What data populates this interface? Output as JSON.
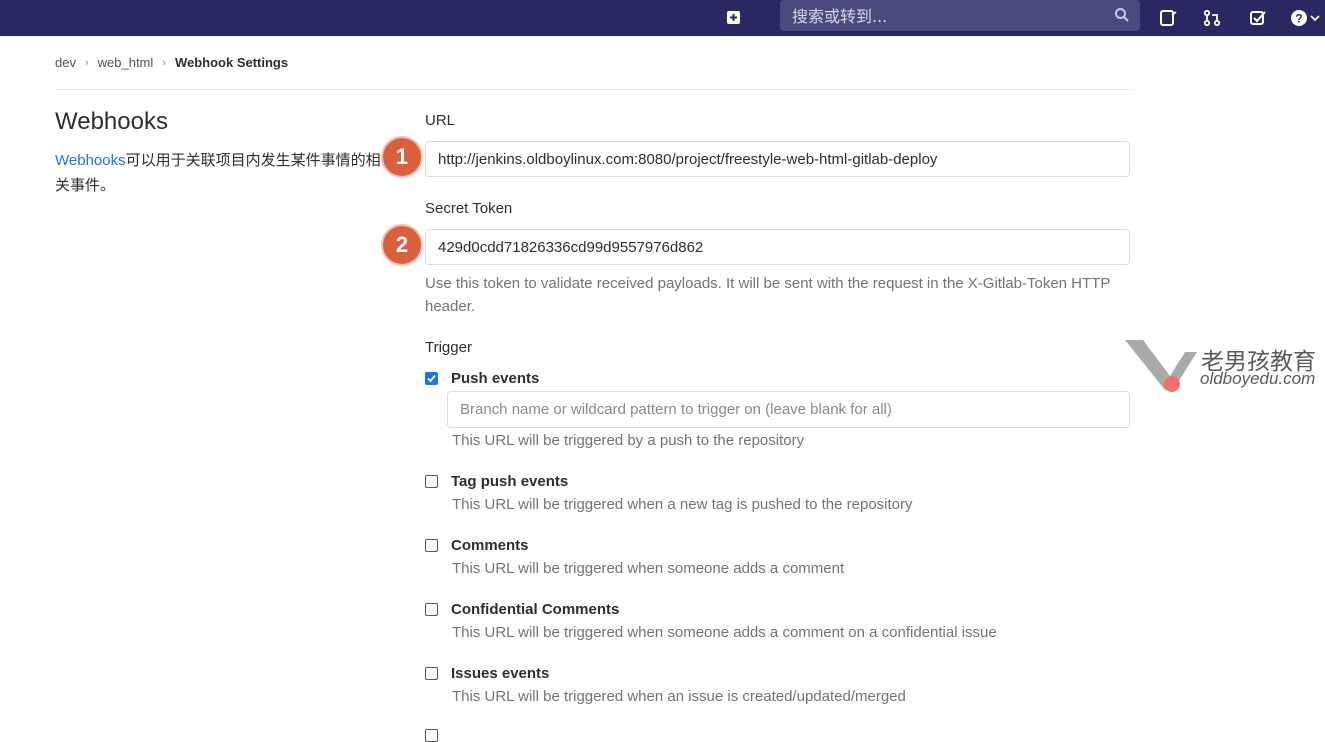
{
  "search": {
    "placeholder": "搜索或转到..."
  },
  "breadcrumb": [
    {
      "label": "dev"
    },
    {
      "label": "web_html"
    },
    {
      "label": "Webhook Settings"
    }
  ],
  "left": {
    "title": "Webhooks",
    "link": "Webhooks",
    "desc": "可以用于关联项目内发生某件事情的相关事件。"
  },
  "form": {
    "url_label": "URL",
    "url_value": "http://jenkins.oldboylinux.com:8080/project/freestyle-web-html-gitlab-deploy",
    "token_label": "Secret Token",
    "token_value": "429d0cdd71826336cd99d9557976d862",
    "token_help": "Use this token to validate received payloads. It will be sent with the request in the X-Gitlab-Token HTTP header.",
    "trigger_label": "Trigger",
    "branch_placeholder": "Branch name or wildcard pattern to trigger on (leave blank for all)"
  },
  "triggers": [
    {
      "label": "Push events",
      "checked": true,
      "help": "This URL will be triggered by a push to the repository"
    },
    {
      "label": "Tag push events",
      "checked": false,
      "help": "This URL will be triggered when a new tag is pushed to the repository"
    },
    {
      "label": "Comments",
      "checked": false,
      "help": "This URL will be triggered when someone adds a comment"
    },
    {
      "label": "Confidential Comments",
      "checked": false,
      "help": "This URL will be triggered when someone adds a comment on a confidential issue"
    },
    {
      "label": "Issues events",
      "checked": false,
      "help": "This URL will be triggered when an issue is created/updated/merged"
    }
  ],
  "badges": [
    "1",
    "2"
  ],
  "watermark": {
    "cn": "老男孩教育",
    "en": "oldboyedu.com"
  },
  "colors": {
    "nav": "#292961",
    "accent": "#1f78d1",
    "badge": "#d9603c"
  }
}
